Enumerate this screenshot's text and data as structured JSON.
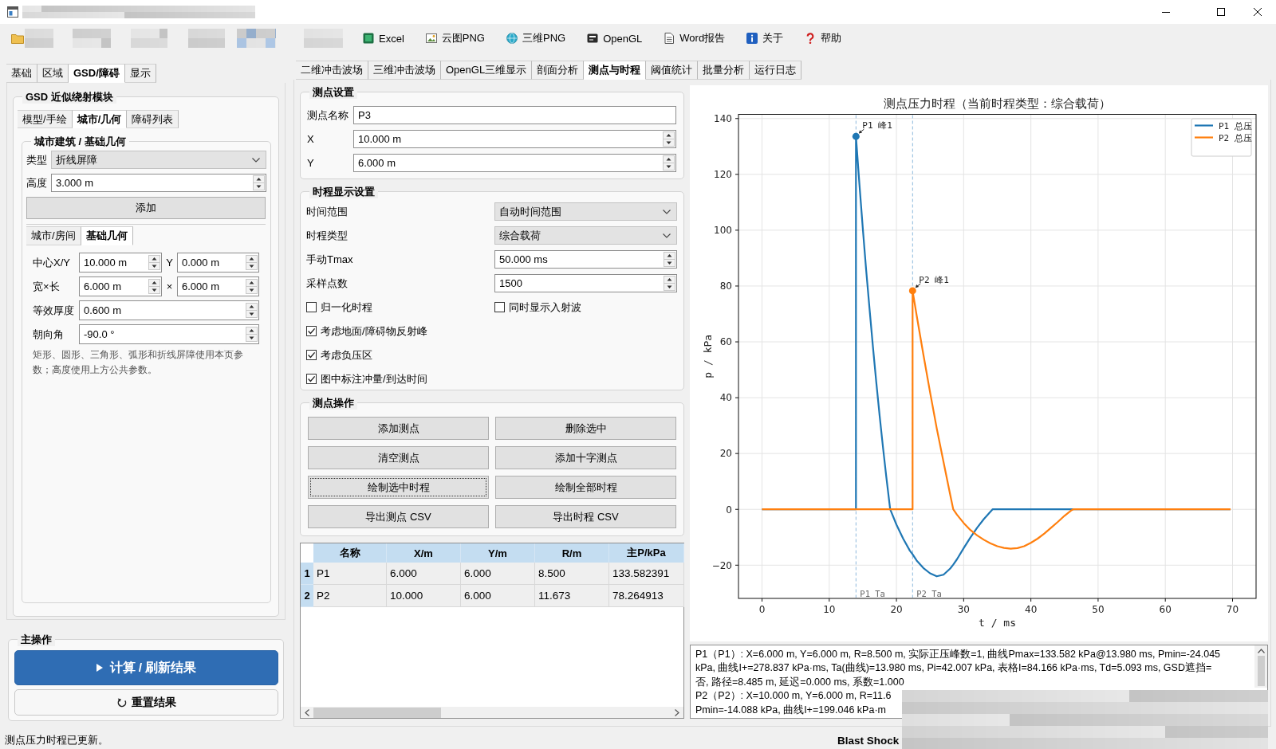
{
  "toolbar": [
    "Excel",
    "云图PNG",
    "三维PNG",
    "OpenGL",
    "Word报告",
    "关于",
    "帮助"
  ],
  "left_panel": {
    "tabs": [
      {
        "label": "基础",
        "selected": false
      },
      {
        "label": "区域",
        "selected": false
      },
      {
        "label": "GSD/障碍",
        "selected": true
      },
      {
        "label": "显示",
        "selected": false
      }
    ],
    "gsd_group": {
      "title": "GSD 近似绕射模块",
      "tabs": [
        {
          "label": "模型/手绘",
          "selected": false
        },
        {
          "label": "城市/几何",
          "selected": true
        },
        {
          "label": "障碍列表",
          "selected": false
        }
      ],
      "city_group": {
        "title": "城市建筑 / 基础几何",
        "fields": [
          {
            "label": "类型",
            "kind": "combo",
            "value": "折线屏障"
          },
          {
            "label": "高度",
            "kind": "spin",
            "value": "3.000 m"
          }
        ],
        "add_button": {
          "label": "添加"
        },
        "tabs": [
          {
            "label": "城市/房间",
            "selected": false
          },
          {
            "label": "基础几何",
            "selected": true
          }
        ],
        "geometry_rows": [
          {
            "label": "中心X/Y",
            "values": [
              "10.000 m",
              "0.000 m"
            ],
            "separator": "Y"
          },
          {
            "label": "宽×长",
            "values": [
              "6.000 m",
              "6.000 m"
            ],
            "separator": "×"
          },
          {
            "label": "等效厚度",
            "values": [
              "0.600 m"
            ]
          },
          {
            "label": "朝向角",
            "values": [
              "-90.0 °"
            ]
          }
        ],
        "note": "矩形、圆形、三角形、弧形和折线屏障使用本页参数；高度使用上方公共参数。"
      }
    },
    "main_actions": {
      "title": "主操作",
      "buttons": [
        {
          "label": "计算 / 刷新结果",
          "kind": "primary"
        },
        {
          "label": "重置结果",
          "kind": "secondary"
        }
      ]
    }
  },
  "center_panel": {
    "tabs": [
      {
        "label": "二维冲击波场",
        "selected": false
      },
      {
        "label": "三维冲击波场",
        "selected": false
      },
      {
        "label": "OpenGL三维显示",
        "selected": false
      },
      {
        "label": "剖面分析",
        "selected": false
      },
      {
        "label": "测点与时程",
        "selected": true
      },
      {
        "label": "阈值统计",
        "selected": false
      },
      {
        "label": "批量分析",
        "selected": false
      },
      {
        "label": "运行日志",
        "selected": false
      }
    ],
    "point_settings": {
      "title": "测点设置",
      "fields": [
        {
          "label": "测点名称",
          "kind": "text",
          "value": "P3"
        },
        {
          "label": "X",
          "kind": "spin",
          "value": "10.000 m"
        },
        {
          "label": "Y",
          "kind": "spin",
          "value": "6.000 m"
        }
      ]
    },
    "display_settings": {
      "title": "时程显示设置",
      "fields": [
        {
          "label": "时间范围",
          "kind": "combo",
          "value": "自动时间范围"
        },
        {
          "label": "时程类型",
          "kind": "combo",
          "value": "综合载荷"
        },
        {
          "label": "手动Tmax",
          "kind": "spin",
          "value": "50.000 ms"
        },
        {
          "label": "采样点数",
          "kind": "spin",
          "value": "1500"
        }
      ],
      "check_rows": [
        [
          {
            "label": "归一化时程",
            "checked": false
          },
          {
            "label": "同时显示入射波",
            "checked": false
          }
        ],
        [
          {
            "label": "考虑地面/障碍物反射峰",
            "checked": true
          }
        ],
        [
          {
            "label": "考虑负压区",
            "checked": true
          }
        ],
        [
          {
            "label": "图中标注冲量/到达时间",
            "checked": true
          }
        ]
      ]
    },
    "point_actions": {
      "title": "测点操作",
      "buttons": [
        {
          "label": "添加测点",
          "focused": false
        },
        {
          "label": "删除选中",
          "focused": false
        },
        {
          "label": "清空测点",
          "focused": false
        },
        {
          "label": "添加十字测点",
          "focused": false
        },
        {
          "label": "绘制选中时程",
          "focused": true
        },
        {
          "label": "绘制全部时程",
          "focused": false
        },
        {
          "label": "导出测点 CSV",
          "focused": false
        },
        {
          "label": "导出时程 CSV",
          "focused": false
        }
      ]
    },
    "points_table": {
      "columns": [
        "名称",
        "X/m",
        "Y/m",
        "R/m",
        "主P/kPa"
      ],
      "rows": [
        {
          "header": "1",
          "cells": [
            "P1",
            "6.000",
            "6.000",
            "8.500",
            "133.582391"
          ]
        },
        {
          "header": "2",
          "cells": [
            "P2",
            "10.000",
            "6.000",
            "11.673",
            "78.264913"
          ]
        }
      ]
    }
  },
  "chart": {
    "chart_data": {
      "type": "line",
      "title": "测点压力时程（当前时程类型：综合载荷）",
      "xlabel": "t / ms",
      "ylabel": "p / kPa",
      "x": [
        0,
        13.98,
        13.98,
        14.5,
        15,
        15.5,
        16,
        16.5,
        17,
        17.5,
        18,
        18.5,
        19.07,
        20,
        21,
        22,
        22.4,
        22.4,
        23,
        24,
        25,
        26,
        27,
        28,
        28.45,
        29,
        30,
        31,
        32,
        33,
        34,
        34.3,
        35,
        36,
        37,
        38,
        39,
        40,
        41,
        42,
        43,
        44,
        45,
        46,
        46.3,
        69.7
      ],
      "series": [
        {
          "name": "P1 总压",
          "color": "#1f77b4",
          "values": [
            0,
            0,
            133.6,
            116.3,
            100.6,
            85.7,
            71.6,
            58.2,
            45.5,
            33.5,
            22.2,
            11.5,
            0,
            -5.5,
            -10.5,
            -14.8,
            -16.1,
            -16.1,
            -18.3,
            -21.0,
            -22.9,
            -24.0,
            -23.4,
            -21.2,
            -19.8,
            -17.9,
            -13.9,
            -10.1,
            -6.6,
            -3.5,
            -0.8,
            0,
            0,
            0,
            0,
            0,
            0,
            0,
            0,
            0,
            0,
            0,
            0,
            0,
            0,
            0
          ]
        },
        {
          "name": "P2 总压",
          "color": "#ff7f0e",
          "values": [
            0,
            0,
            0,
            0,
            0,
            0,
            0,
            0,
            0,
            0,
            0,
            0,
            0,
            0,
            0,
            0,
            0,
            78.3,
            69.5,
            55.5,
            42,
            29,
            17,
            5.2,
            0,
            -1.9,
            -4.9,
            -7.4,
            -9.3,
            -10.9,
            -12.2,
            -12.5,
            -13.2,
            -13.8,
            -14.1,
            -13.9,
            -13.2,
            -12.0,
            -10.5,
            -8.7,
            -6.6,
            -4.5,
            -2.3,
            -0.4,
            0,
            0
          ]
        }
      ],
      "xlim": [
        -3.5,
        73.5
      ],
      "ylim": [
        -31.9,
        141.5
      ],
      "xticks": [
        0,
        10,
        20,
        30,
        40,
        50,
        60,
        70
      ],
      "yticks": [
        {
          "value": -20,
          "label": "−20"
        },
        0,
        20,
        40,
        60,
        80,
        100,
        120,
        140
      ],
      "grid": true,
      "legend": "upper right",
      "ref_lines": [
        {
          "axis": "x",
          "value": 13.98,
          "label": "P1 Ta"
        },
        {
          "axis": "x",
          "value": 22.4,
          "label": "P2 Ta"
        }
      ],
      "annotations": [
        {
          "text": "P1 峰1",
          "x": 13.98,
          "y": 133.6
        },
        {
          "text": "P2 峰1",
          "x": 22.4,
          "y": 78.3
        }
      ]
    }
  },
  "report": {
    "lines": [
      "P1（P1）: X=6.000 m, Y=6.000 m, R=8.500 m, 实际正压峰数=1, 曲线Pmax=133.582 kPa@13.980 ms, Pmin=-24.045",
      "kPa, 曲线I+=278.837 kPa·ms, Ta(曲线)=13.980 ms, Pi=42.007 kPa, 表格I=84.166 kPa·ms, Td=5.093 ms, GSD遮挡=",
      "否, 路径=8.485 m, 延迟=0.000 ms, 系数=1.000",
      "P2（P2）: X=10.000 m, Y=6.000 m, R=11.6",
      "Pmin=-14.088 kPa, 曲线I+=199.046 kPa·m"
    ]
  },
  "status_bar": {
    "message": "测点压力时程已更新。",
    "app_text": "Blast Shock"
  }
}
